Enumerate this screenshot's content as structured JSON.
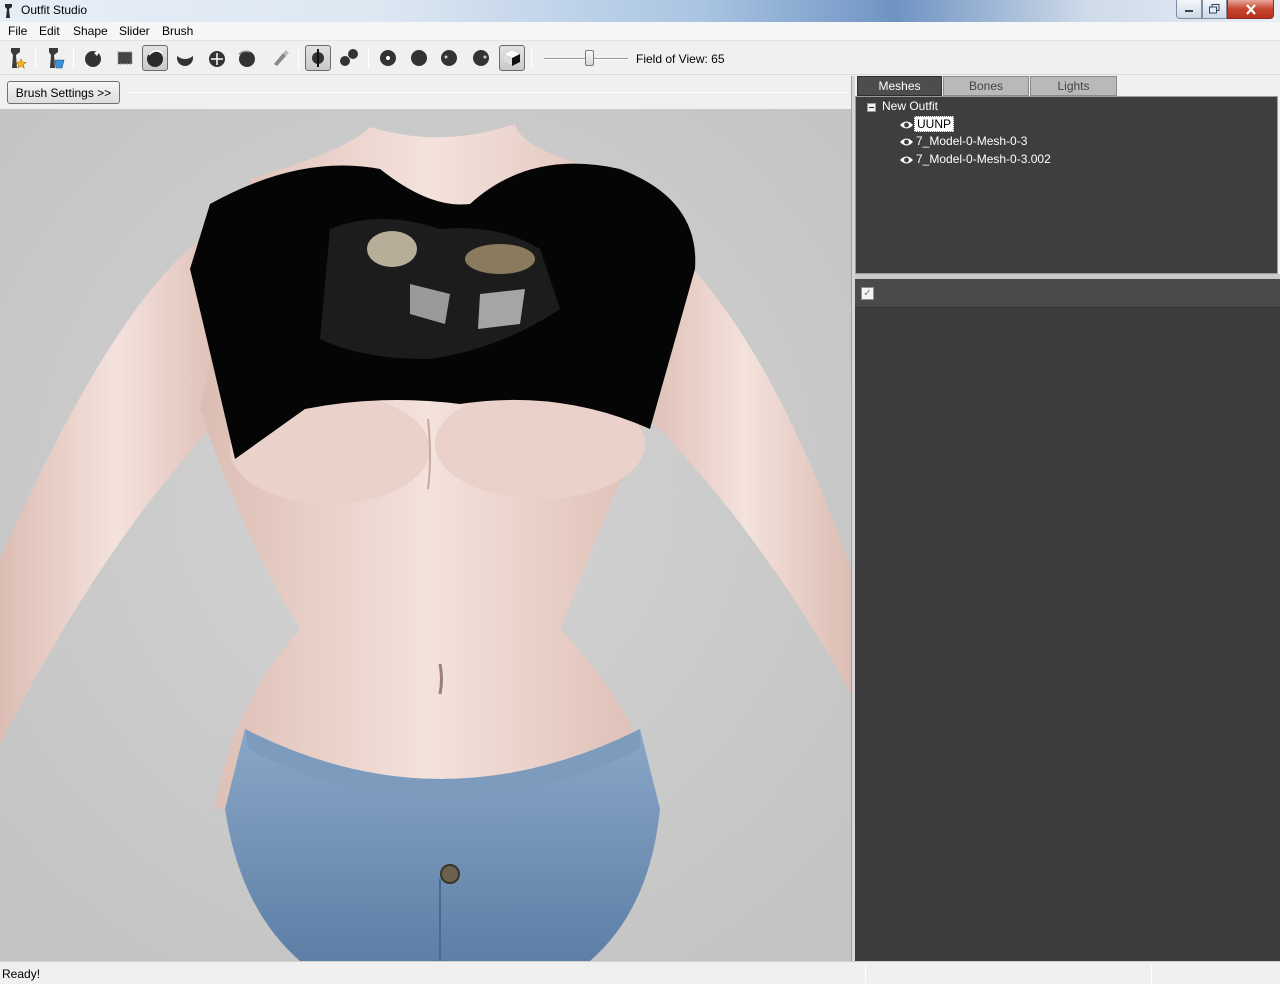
{
  "window": {
    "title": "Outfit Studio"
  },
  "menu": {
    "items": [
      "File",
      "Edit",
      "Shape",
      "Slider",
      "Brush"
    ]
  },
  "toolbar": {
    "tools": [
      "load-reference-icon",
      "load-outfit-icon",
      "select-brush-icon",
      "mask-brush-icon",
      "inflate-brush-icon",
      "deflate-brush-icon",
      "move-brush-icon",
      "smooth-brush-icon",
      "weight-brush-icon",
      "mirror-icon",
      "connected-icon",
      "vertex-icon",
      "wireframe-icon",
      "lighting-icon",
      "texture-icon",
      "cube-view-icon"
    ],
    "fov_label": "Field of View: 65",
    "fov_value": 65,
    "fov_range": [
      10,
      110
    ]
  },
  "brush_panel": {
    "settings_button": "Brush Settings >>"
  },
  "tabs": {
    "items": [
      "Meshes",
      "Bones",
      "Lights"
    ],
    "selected": "Meshes"
  },
  "tree": {
    "root": "New Outfit",
    "meshes": [
      {
        "name": "UUNP",
        "selected": true
      },
      {
        "name": "7_Model-0-Mesh-0-3",
        "selected": false
      },
      {
        "name": "7_Model-0-Mesh-0-3.002",
        "selected": false
      }
    ]
  },
  "slider_panel": {
    "checkbox_checked": true
  },
  "status": {
    "text": "Ready!"
  }
}
